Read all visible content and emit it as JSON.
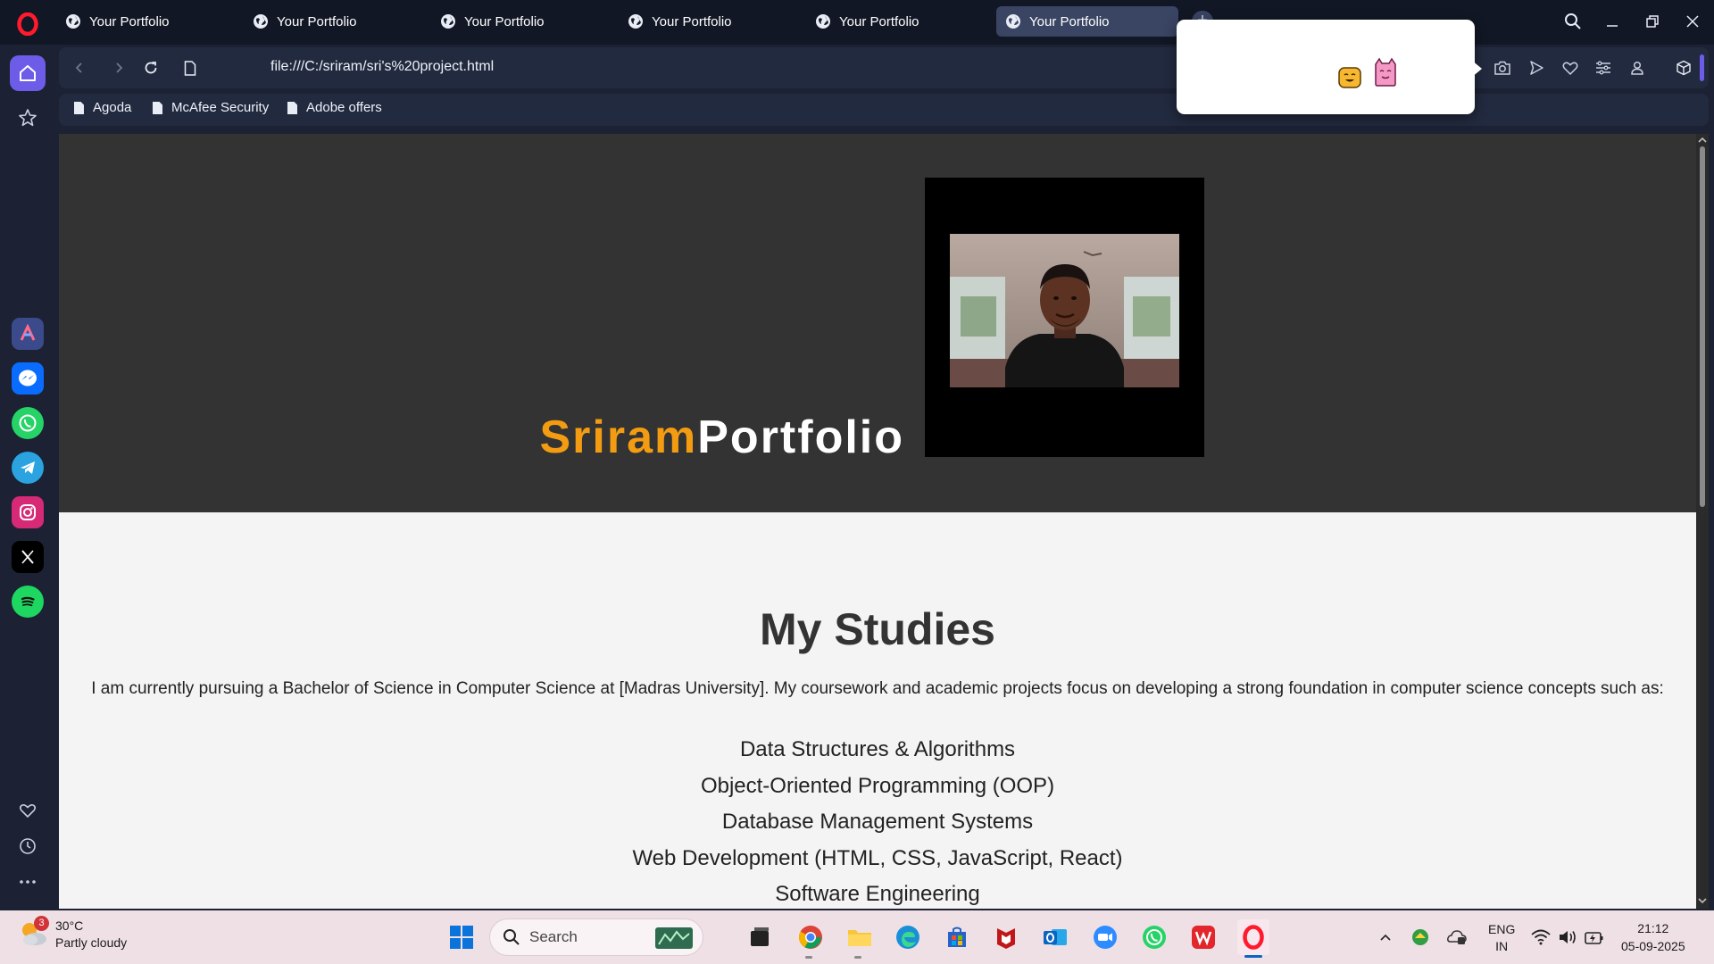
{
  "browser": {
    "tabs": [
      {
        "label": "Your Portfolio",
        "active": false
      },
      {
        "label": "Your Portfolio",
        "active": false
      },
      {
        "label": "Your Portfolio",
        "active": false
      },
      {
        "label": "Your Portfolio",
        "active": false
      },
      {
        "label": "Your Portfolio",
        "active": false
      },
      {
        "label": "Your Portfolio",
        "active": true
      }
    ],
    "new_tab": "+",
    "url": "file:///C:/sriram/sri's%20project.html",
    "bookmarks": [
      {
        "label": "Agoda"
      },
      {
        "label": "McAfee Security"
      },
      {
        "label": "Adobe offers"
      }
    ],
    "accent": "#6c5ce7"
  },
  "page": {
    "brand_name": "Sriram",
    "brand_rest": "Portfolio",
    "brand_color": "#f39c12",
    "hero_bg": "#333333",
    "studies": {
      "title": "My Studies",
      "intro": "I am currently pursuing a Bachelor of Science in Computer Science at [Madras University]. My coursework and academic projects focus on developing a strong foundation in computer science concepts such as:",
      "courses": [
        "Data Structures & Algorithms",
        "Object-Oriented Programming (OOP)",
        "Database Management Systems",
        "Web Development (HTML, CSS, JavaScript, React)",
        "Software Engineering"
      ]
    }
  },
  "taskbar": {
    "weather": {
      "temp": "30°C",
      "condition": "Partly cloudy",
      "badge": "3"
    },
    "search_label": "Search",
    "language": {
      "line1": "ENG",
      "line2": "IN"
    },
    "clock": {
      "time": "21:12",
      "date": "05-09-2025"
    }
  }
}
